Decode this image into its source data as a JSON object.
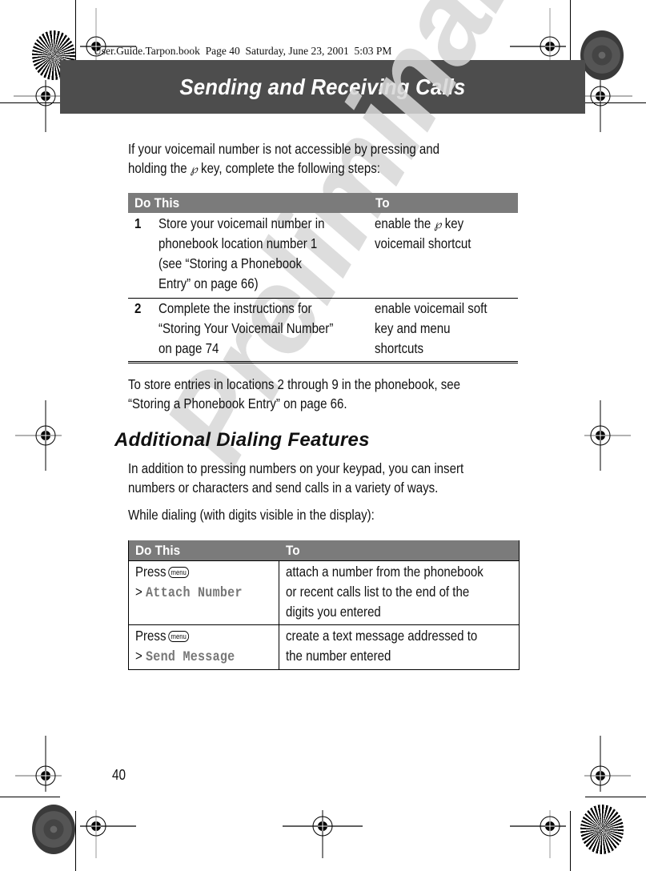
{
  "print_meta": "User.Guide.Tarpon.book  Page 40  Saturday, June 23, 2001  5:03 PM",
  "chapter_title": "Sending and Receiving Calls",
  "watermark": "Preliminary",
  "intro": {
    "line1": "If your voicemail number is not accessible by pressing and",
    "line2_pre": "holding the",
    "line2_icon": "voicemail-key-icon",
    "line2_post": "key, complete the following steps:"
  },
  "table1": {
    "headers": [
      "Do This",
      "To"
    ],
    "rows": [
      {
        "num": "1",
        "do_lines": [
          "Store your voicemail number in",
          "phonebook location number 1",
          "(see “Storing a Phonebook",
          "Entry” on page 66)"
        ],
        "to_line1_pre": "enable the",
        "to_line1_post": "key",
        "to_line2": "voicemail shortcut"
      },
      {
        "num": "2",
        "do_lines": [
          "Complete the instructions for",
          "“Storing Your Voicemail Number”",
          "on page 74"
        ],
        "to_lines": [
          "enable voicemail soft",
          "key and menu",
          "shortcuts"
        ]
      }
    ]
  },
  "after_table": {
    "line1": "To store entries in locations 2 through 9 in the phonebook, see",
    "line2": "“Storing a Phonebook Entry” on page 66."
  },
  "section": {
    "heading": "Additional Dialing Features",
    "para1_line1": "In addition to pressing numbers on your keypad, you can insert",
    "para1_line2": "numbers or characters and send calls in a variety of ways.",
    "para2": "While dialing (with digits visible in the display):"
  },
  "table2": {
    "headers": [
      "Do This",
      "To"
    ],
    "rows": [
      {
        "press": "Press",
        "key": "menu",
        "arrow": ">",
        "menu_item": "Attach Number",
        "to_lines": [
          "attach a number from the phonebook",
          "or recent calls list to the end of the",
          "digits you entered"
        ]
      },
      {
        "press": "Press",
        "key": "menu",
        "arrow": ">",
        "menu_item": "Send Message",
        "to_lines": [
          "create a text message addressed to",
          "the number entered"
        ]
      }
    ]
  },
  "page_number": "40"
}
